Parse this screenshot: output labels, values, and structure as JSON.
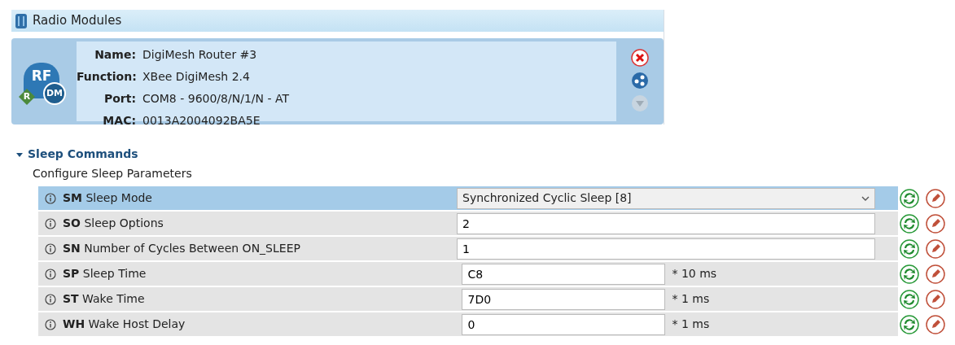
{
  "panel": {
    "title": "Radio Modules"
  },
  "module": {
    "fields": [
      {
        "label": "Name:",
        "value": "DigiMesh Router #3"
      },
      {
        "label": "Function:",
        "value": "XBee DigiMesh 2.4"
      },
      {
        "label": "Port:",
        "value": "COM8 - 9600/8/N/1/N - AT"
      },
      {
        "label": "MAC:",
        "value": "0013A2004092BA5E"
      }
    ],
    "badge_top": "RF",
    "badge_left": "R",
    "badge_right": "DM",
    "actions": [
      {
        "kind": "remove",
        "disabled": false
      },
      {
        "kind": "discover",
        "disabled": false
      },
      {
        "kind": "more",
        "disabled": true
      }
    ]
  },
  "section": {
    "title": "Sleep Commands",
    "expanded": true,
    "description": "Configure Sleep Parameters"
  },
  "settings": [
    {
      "code": "SM",
      "name": "Sleep Mode",
      "kind": "select",
      "value": "Synchronized Cyclic Sleep [8]",
      "selected": true
    },
    {
      "code": "SO",
      "name": "Sleep Options",
      "kind": "text",
      "value": "2",
      "selected": false
    },
    {
      "code": "SN",
      "name": "Number of Cycles Between ON_SLEEP",
      "kind": "text",
      "value": "1",
      "selected": false
    },
    {
      "code": "SP",
      "name": "Sleep Time",
      "kind": "unit",
      "value": "C8",
      "unit": "* 10 ms",
      "selected": false
    },
    {
      "code": "ST",
      "name": "Wake Time",
      "kind": "unit",
      "value": "7D0",
      "unit": "* 1 ms",
      "selected": false
    },
    {
      "code": "WH",
      "name": "Wake Host Delay",
      "kind": "unit",
      "value": "0",
      "unit": "* 1 ms",
      "selected": false
    }
  ]
}
